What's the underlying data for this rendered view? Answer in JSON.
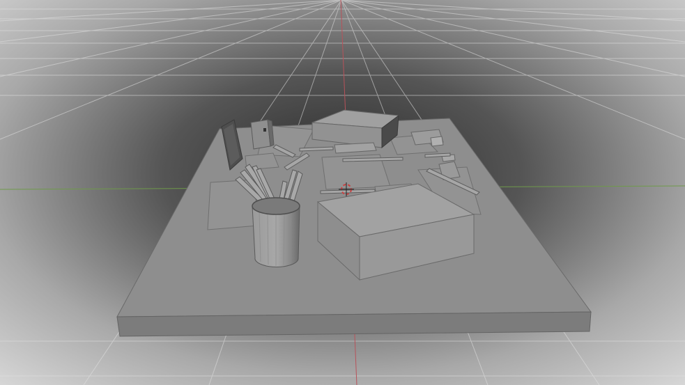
{
  "viewport": {
    "label": "3D viewport",
    "view": "perspective",
    "shading": "solid",
    "grid": true,
    "axis_x_color": "#b8525a",
    "axis_y_color": "#6f9a4a",
    "origin_marker": "3d-cursor-icon"
  },
  "scene": {
    "objects": [
      {
        "name": "desk-board",
        "kind": "slab"
      },
      {
        "name": "pencil-cup",
        "kind": "cylinder"
      },
      {
        "name": "large-box",
        "kind": "box"
      },
      {
        "name": "back-box",
        "kind": "box"
      },
      {
        "name": "photo-frame",
        "kind": "panel"
      },
      {
        "name": "small-device",
        "kind": "box"
      },
      {
        "name": "pens",
        "kind": "rod"
      },
      {
        "name": "papers",
        "kind": "sheet"
      },
      {
        "name": "erasers",
        "kind": "box"
      }
    ]
  },
  "colors": {
    "background_center": "#2e2e2e",
    "background_edge": "#d6d6d6",
    "grid_line": "#dcdcdc",
    "surface_top": "#8f8f8f",
    "surface_side": "#7a7a7a",
    "object_light": "#a3a3a3",
    "object_mid": "#8c8c8c",
    "object_dark": "#5e5e5e"
  }
}
